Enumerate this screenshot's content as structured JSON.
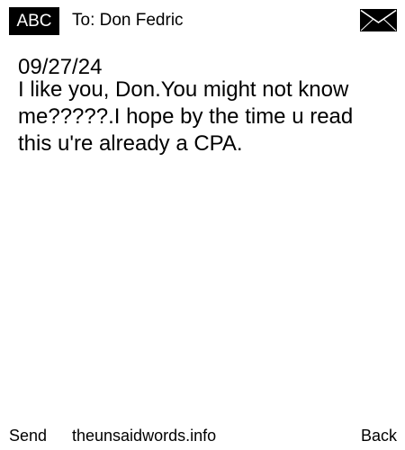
{
  "header": {
    "brand": "ABC",
    "to_line": "To: Don Fedric",
    "icon": "envelope-icon"
  },
  "message": {
    "date": "09/27/24",
    "body": "I like you, Don.You might not know me?????.I hope by the time u read this u're already a CPA."
  },
  "footer": {
    "send_label": "Send",
    "site": "theunsaidwords.info",
    "back_label": "Back"
  }
}
